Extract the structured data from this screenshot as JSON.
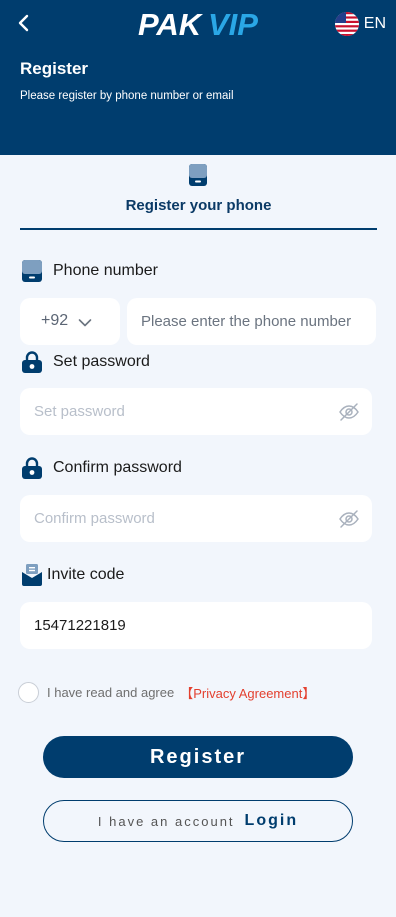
{
  "header": {
    "logo_text": "PAKVIP",
    "language": "EN",
    "title": "Register",
    "subtitle": "Please register by phone number or email"
  },
  "tab": {
    "label": "Register your phone"
  },
  "phone": {
    "label": "Phone number",
    "country_code": "+92",
    "placeholder": "Please enter the phone number"
  },
  "password": {
    "label": "Set password",
    "placeholder": "Set password"
  },
  "confirm": {
    "label": "Confirm password",
    "placeholder": "Confirm password"
  },
  "invite": {
    "label": "Invite code",
    "value": "15471221819"
  },
  "agreement": {
    "text": "I have read and agree",
    "link": "【Privacy Agreement】"
  },
  "buttons": {
    "register": "Register",
    "have_account": "I have an account",
    "login": "Login"
  },
  "colors": {
    "primary": "#003d6e",
    "background": "#f2f6fc",
    "link": "#e3402f"
  },
  "icons": [
    "back-icon",
    "us-flag-icon",
    "phone-icon",
    "lock-icon",
    "eye-off-icon",
    "invite-icon",
    "chevron-down-icon"
  ]
}
